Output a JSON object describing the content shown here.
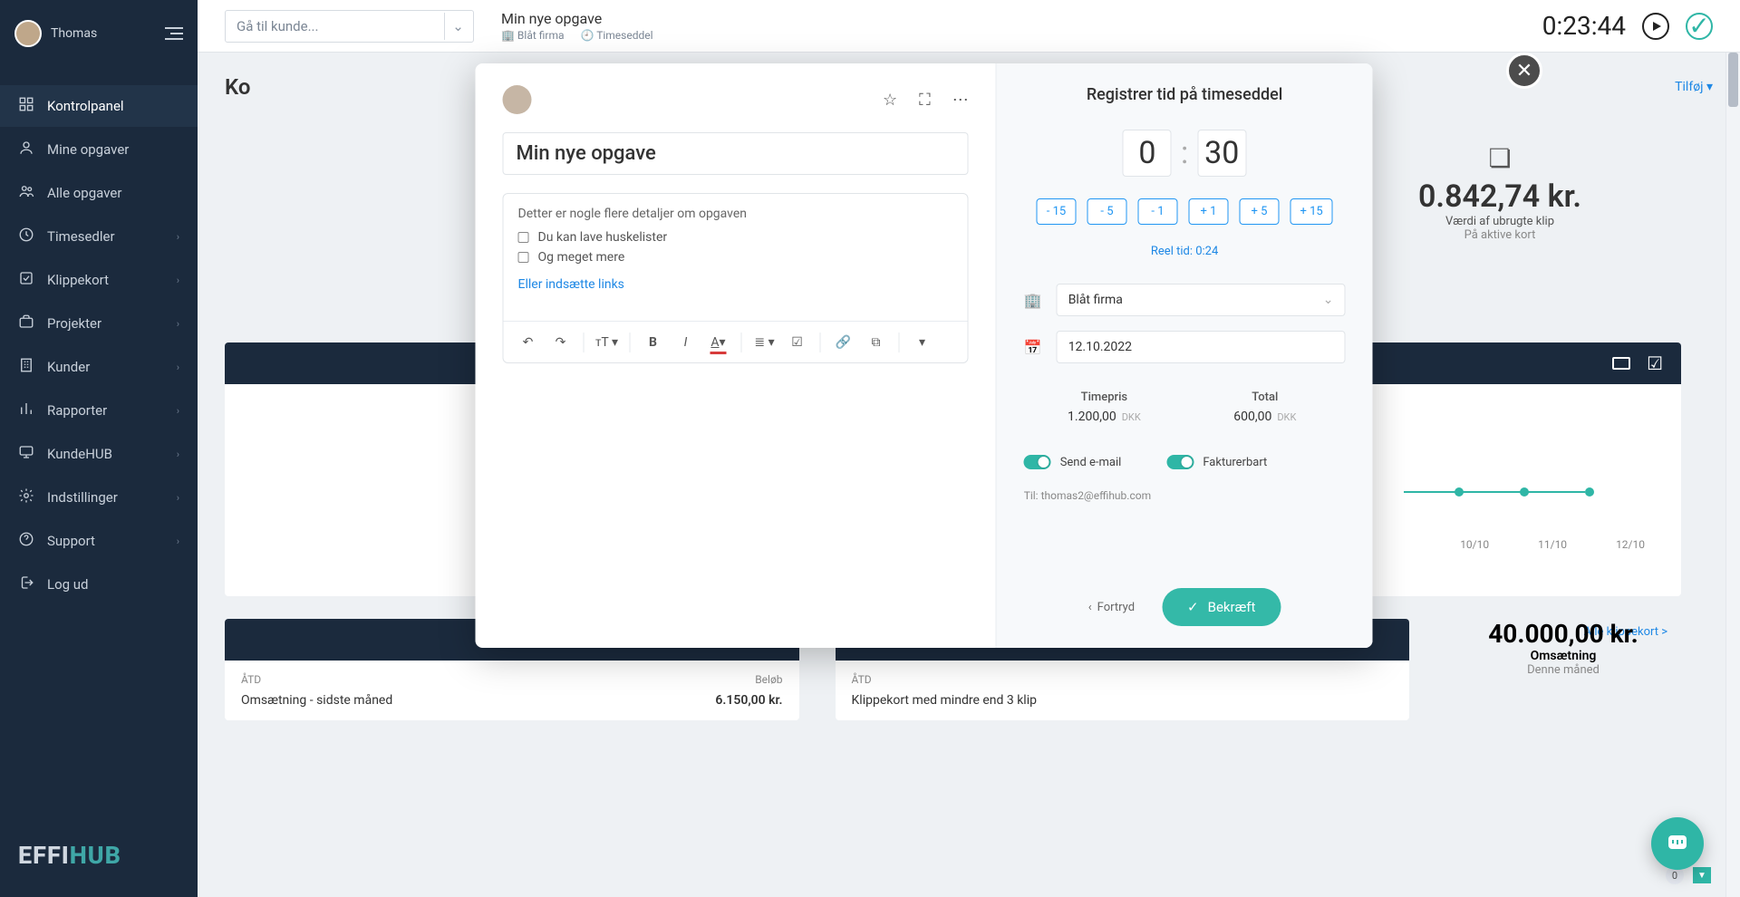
{
  "sidebar": {
    "user_name": "Thomas",
    "items": [
      {
        "label": "Kontrolpanel",
        "expandable": false,
        "active": true,
        "icon": "grid"
      },
      {
        "label": "Mine opgaver",
        "expandable": false,
        "active": false,
        "icon": "user"
      },
      {
        "label": "Alle opgaver",
        "expandable": false,
        "active": false,
        "icon": "users"
      },
      {
        "label": "Timesedler",
        "expandable": true,
        "active": false,
        "icon": "clock"
      },
      {
        "label": "Klippekort",
        "expandable": true,
        "active": false,
        "icon": "check-square"
      },
      {
        "label": "Projekter",
        "expandable": true,
        "active": false,
        "icon": "briefcase"
      },
      {
        "label": "Kunder",
        "expandable": true,
        "active": false,
        "icon": "building"
      },
      {
        "label": "Rapporter",
        "expandable": true,
        "active": false,
        "icon": "bar-chart"
      },
      {
        "label": "KundeHUB",
        "expandable": true,
        "active": false,
        "icon": "monitor"
      },
      {
        "label": "Indstillinger",
        "expandable": true,
        "active": false,
        "icon": "gear"
      },
      {
        "label": "Support",
        "expandable": true,
        "active": false,
        "icon": "help"
      },
      {
        "label": "Log ud",
        "expandable": false,
        "active": false,
        "icon": "logout"
      }
    ],
    "logo_a": "EFFI",
    "logo_b": "HUB"
  },
  "topbar": {
    "search_placeholder": "Gå til kunde...",
    "task_title": "Min nye opgave",
    "company": "Blåt firma",
    "timesheet_label": "Timeseddel",
    "timer": "0:23:44"
  },
  "page": {
    "title_partial": "Ko",
    "tilfoej": "Tilføj",
    "kpi": {
      "value": "0.842,74 kr.",
      "line1": "Værdi af ubrugte klip",
      "line2": "På aktive kort"
    },
    "chart_x": [
      "10/10",
      "11/10",
      "12/10"
    ],
    "alle_klippekort": "Alle klippekort >",
    "col_atd": "ÅTD",
    "col_beloeb": "Beløb",
    "left_row": "Omsætning - sidste måned",
    "left_row_val": "6.150,00 kr.",
    "right_row": "Klippekort med mindre end 3 klip",
    "kpi2_val": "40.000,00 kr.",
    "kpi2_l1": "Omsætning",
    "kpi2_l2": "Denne måned",
    "badge_zero": "0"
  },
  "modal": {
    "task_title": "Min nye opgave",
    "desc_intro": "Detter er nogle flere detaljer om opgaven",
    "check1": "Du kan lave huskelister",
    "check2": "Og meget mere",
    "link_text": "Eller indsætte links",
    "right_title": "Registrer tid på timeseddel",
    "hours": "0",
    "minutes": "30",
    "adjust": [
      "- 15",
      "- 5",
      "- 1",
      "+ 1",
      "+ 5",
      "+ 15"
    ],
    "reel": "Reel tid: 0:24",
    "company": "Blåt firma",
    "date": "12.10.2022",
    "price_h1": "Timepris",
    "price_h2": "Total",
    "rate_num": "1.200,00",
    "rate_cur": "DKK",
    "total_num": "600,00",
    "total_cur": "DKK",
    "toggle_email": "Send e-mail",
    "toggle_bill": "Fakturerbart",
    "to_line": "Til: thomas2@effihub.com",
    "cancel": "Fortryd",
    "confirm": "Bekræft"
  }
}
